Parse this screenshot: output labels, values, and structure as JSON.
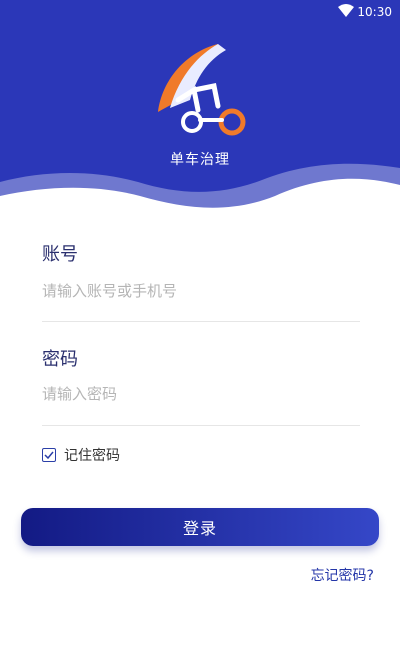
{
  "status_bar": {
    "time": "10:30",
    "wifi_icon": "wifi-icon"
  },
  "header": {
    "app_name": "单车治理",
    "logo_icon": "bike-logo-icon",
    "colors": {
      "primary": "#2b37b8",
      "wave": "#6f78cf",
      "accent": "#f07a2a"
    }
  },
  "form": {
    "account": {
      "label": "账号",
      "placeholder": "请输入账号或手机号",
      "value": ""
    },
    "password": {
      "label": "密码",
      "placeholder": "请输入密码",
      "value": ""
    },
    "remember": {
      "label": "记住密码",
      "checked": true
    }
  },
  "actions": {
    "login_label": "登录",
    "forgot_label": "忘记密码?"
  }
}
